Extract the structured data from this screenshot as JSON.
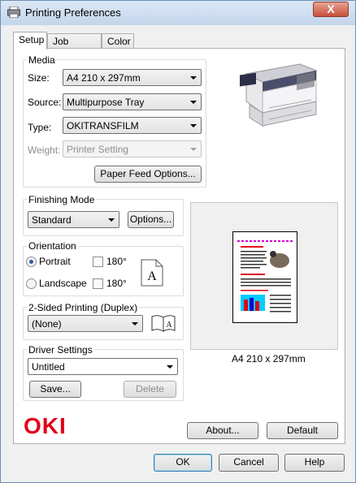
{
  "window": {
    "title": "Printing Preferences",
    "close_symbol": "X"
  },
  "tabs": [
    {
      "label": "Setup",
      "active": true
    },
    {
      "label": "Job Options",
      "active": false
    },
    {
      "label": "Color",
      "active": false
    }
  ],
  "media": {
    "title": "Media",
    "size_label": "Size:",
    "size_value": "A4 210 x 297mm",
    "source_label": "Source:",
    "source_value": "Multipurpose Tray",
    "type_label": "Type:",
    "type_value": "OKITRANSFILM",
    "weight_label": "Weight:",
    "weight_value": "Printer Setting",
    "paper_feed_button": "Paper Feed Options..."
  },
  "finishing": {
    "title": "Finishing Mode",
    "value": "Standard",
    "options_button": "Options..."
  },
  "orientation": {
    "title": "Orientation",
    "portrait_label": "Portrait",
    "landscape_label": "Landscape",
    "rotate_label_1": "180°",
    "rotate_label_2": "180°",
    "selected": "Portrait",
    "icon_letter": "A"
  },
  "duplex": {
    "title": "2-Sided Printing (Duplex)",
    "value": "(None)",
    "icon_letter": "A"
  },
  "driver": {
    "title": "Driver Settings",
    "value": "Untitled",
    "save_button": "Save...",
    "delete_button": "Delete"
  },
  "preview": {
    "caption": "A4 210 x 297mm"
  },
  "brand": {
    "logo": "OKI",
    "color": "#e2001a"
  },
  "bottom_buttons": {
    "about": "About...",
    "default": "Default"
  },
  "dialog_buttons": {
    "ok": "OK",
    "cancel": "Cancel",
    "help": "Help"
  }
}
